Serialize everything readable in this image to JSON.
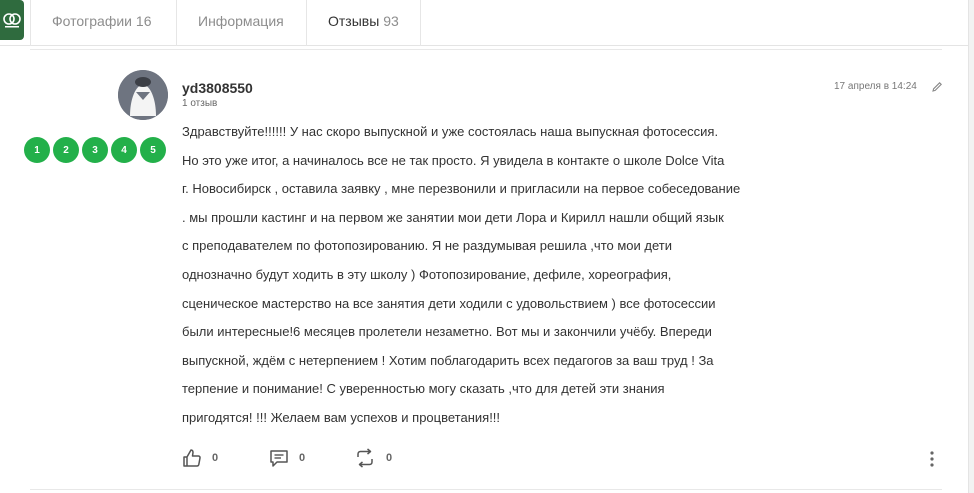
{
  "tabs": [
    {
      "label": "Фотографии",
      "count": "16"
    },
    {
      "label": "Информация",
      "count": ""
    },
    {
      "label": "Отзывы",
      "count": "93"
    }
  ],
  "review": {
    "user": {
      "name": "yd3808550",
      "reviews_count": "1 отзыв"
    },
    "date": "17 апреля в 14:24",
    "rating_buttons": [
      "1",
      "2",
      "3",
      "4",
      "5"
    ],
    "text_lines": [
      "Здравствуйте!!!!!! У нас скоро выпускной и уже состоялась наша выпускная фотосессия.",
      "Но это уже итог, а начиналось все не так просто. Я увидела в контакте о школе Dolce Vita",
      "г. Новосибирск , оставила заявку , мне перезвонили и пригласили на первое собеседование",
      ". мы прошли кастинг и на первом же занятии мои дети Лора и Кирилл нашли общий язык",
      "с преподавателем по фотопозированию. Я не раздумывая решила ,что мои дети",
      "однозначно будут ходить в эту школу ) Фотопозирование, дефиле, хореография,",
      "сценическое мастерство на все занятия дети ходили с удовольствием ) все фотосессии",
      "были интересные!6 месяцев пролетели незаметно. Вот мы и закончили учёбу. Впереди",
      "выпускной, ждём с нетерпением ! Хотим поблагодарить всех педагогов за ваш труд ! За",
      "терпение и понимание! С уверенностью могу сказать ,что для детей эти знания",
      "пригодятся! !!! Желаем вам успехов и процветания!!!"
    ],
    "actions": {
      "likes": "0",
      "comments": "0",
      "reposts": "0"
    }
  },
  "colors": {
    "rating_green": "#23b04a",
    "logo_green": "#2f6b3e"
  },
  "icons": [
    "logo-icon",
    "avatar-icon",
    "pencil-icon",
    "thumbs-up-icon",
    "comment-icon",
    "repost-icon",
    "more-vertical-icon"
  ]
}
